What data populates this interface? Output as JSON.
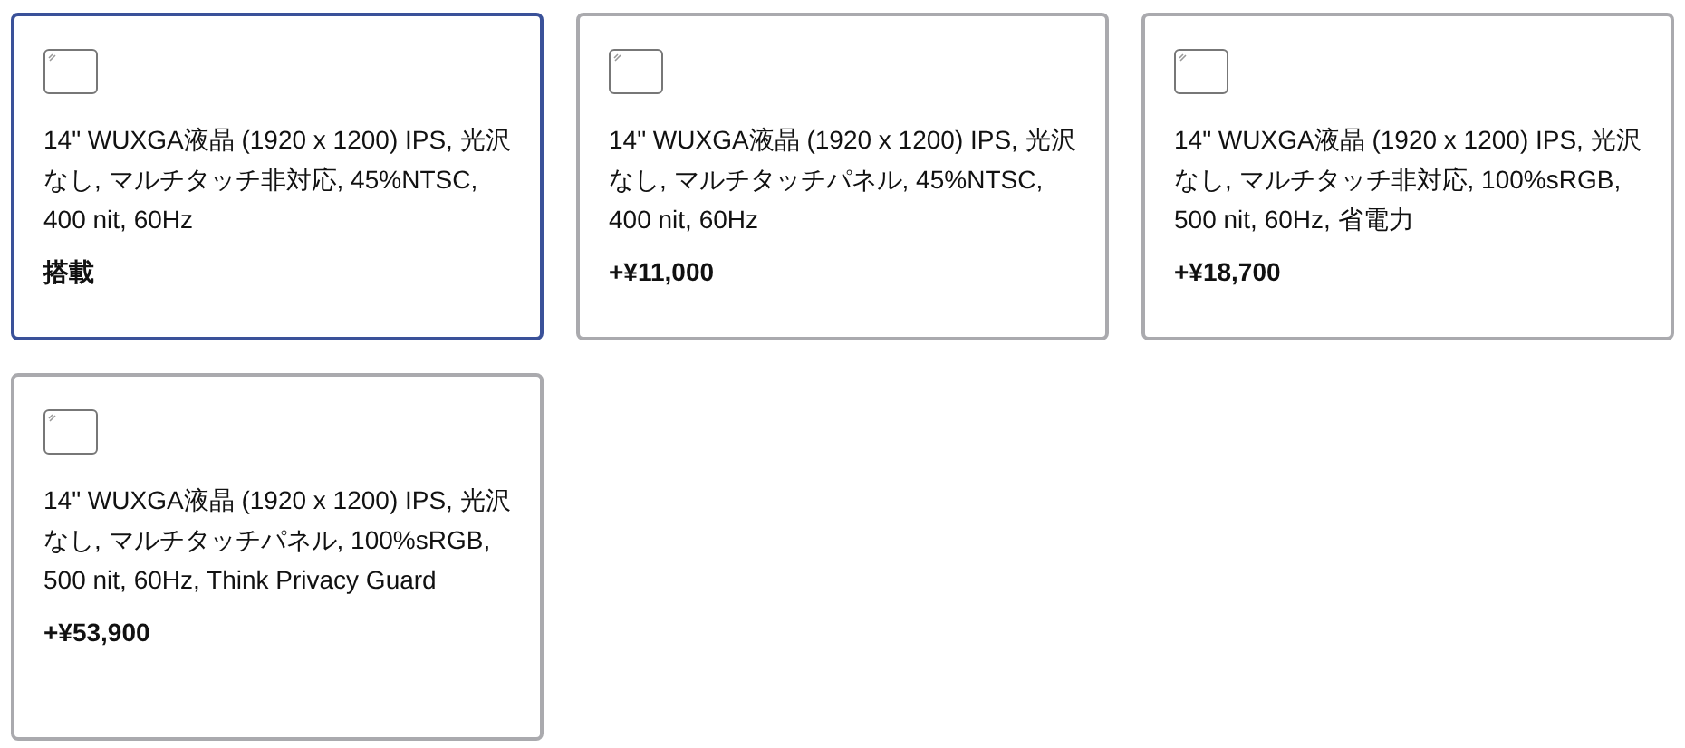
{
  "options": [
    {
      "description": "14\" WUXGA液晶 (1920 x 1200) IPS, 光沢なし, マルチタッチ非対応, 45%NTSC, 400 nit, 60Hz",
      "price": "搭載",
      "selected": true
    },
    {
      "description": "14\" WUXGA液晶 (1920 x 1200) IPS, 光沢なし, マルチタッチパネル, 45%NTSC, 400 nit, 60Hz",
      "price": "+¥11,000",
      "selected": false
    },
    {
      "description": "14\" WUXGA液晶 (1920 x 1200) IPS, 光沢なし, マルチタッチ非対応, 100%sRGB, 500 nit, 60Hz, 省電力",
      "price": "+¥18,700",
      "selected": false
    },
    {
      "description": "14\" WUXGA液晶 (1920 x 1200) IPS, 光沢なし, マルチタッチパネル, 100%sRGB, 500 nit, 60Hz, Think Privacy Guard",
      "price": "+¥53,900",
      "selected": false
    }
  ]
}
